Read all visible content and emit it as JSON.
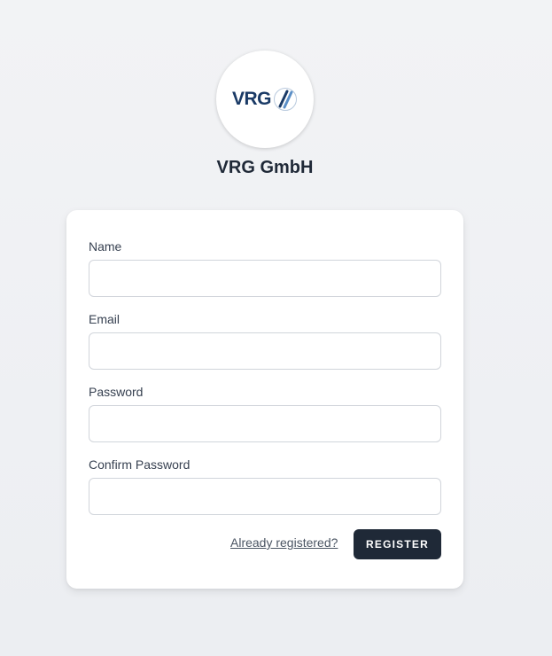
{
  "brand": {
    "logo_text": "VRG",
    "company_name": "VRG GmbH",
    "primary_color": "#1a3a66",
    "accent_color": "#5b8fc7"
  },
  "form": {
    "name": {
      "label": "Name",
      "value": "",
      "placeholder": ""
    },
    "email": {
      "label": "Email",
      "value": "",
      "placeholder": ""
    },
    "password": {
      "label": "Password",
      "value": "",
      "placeholder": ""
    },
    "confirm_password": {
      "label": "Confirm Password",
      "value": "",
      "placeholder": ""
    },
    "already_registered_link": "Already registered?",
    "register_button": "REGISTER"
  }
}
